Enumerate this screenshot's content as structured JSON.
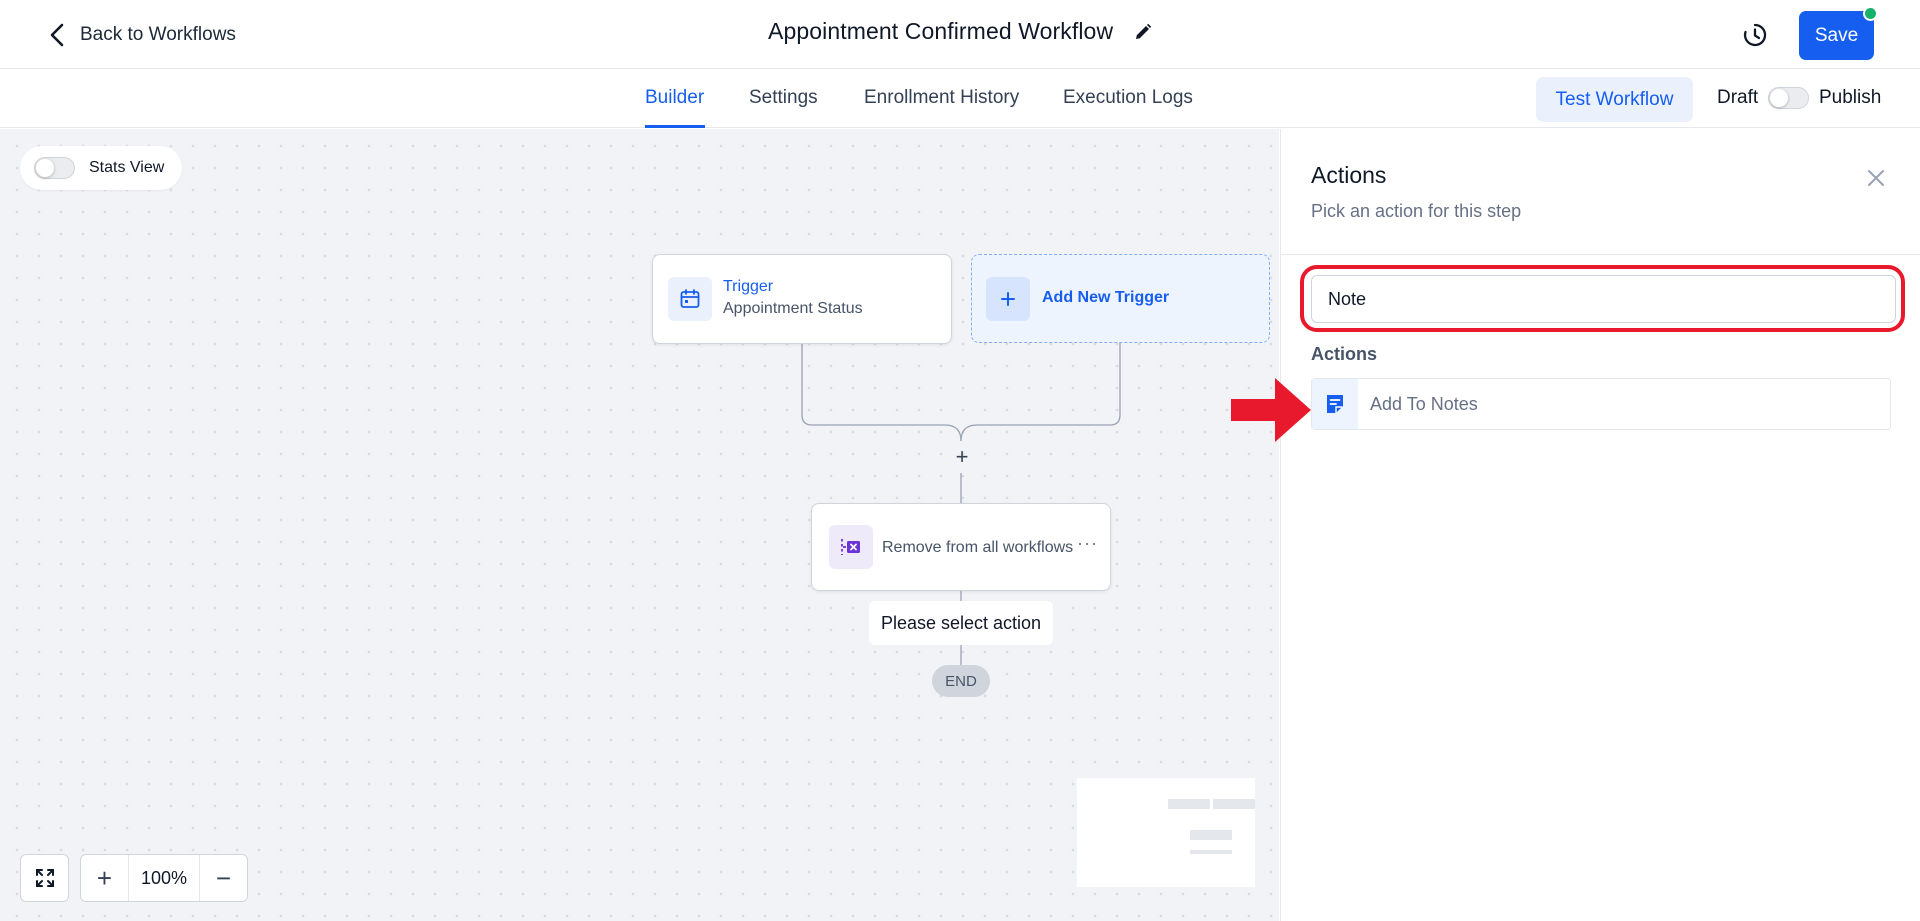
{
  "header": {
    "back_label": "Back to Workflows",
    "title": "Appointment Confirmed Workflow",
    "save_label": "Save"
  },
  "tabs": [
    {
      "label": "Builder",
      "active": true
    },
    {
      "label": "Settings",
      "active": false
    },
    {
      "label": "Enrollment History",
      "active": false
    },
    {
      "label": "Execution Logs",
      "active": false
    }
  ],
  "toolbar": {
    "test_label": "Test Workflow",
    "draft_label": "Draft",
    "publish_label": "Publish",
    "published": false
  },
  "canvas": {
    "stats_label": "Stats View",
    "stats_on": false,
    "trigger": {
      "label": "Trigger",
      "subtitle": "Appointment Status"
    },
    "add_trigger_label": "Add New Trigger",
    "action": {
      "label": "Remove from all workflows",
      "more": "···"
    },
    "select_action_label": "Please select action",
    "end_label": "END",
    "add_step_symbol": "+",
    "zoom": {
      "value": "100%",
      "in": "+",
      "out": "−"
    }
  },
  "panel": {
    "title": "Actions",
    "subtitle": "Pick an action for this step",
    "search_value": "Note",
    "section_label": "Actions",
    "options": [
      {
        "label": "Add To Notes",
        "icon": "note-icon"
      }
    ]
  },
  "colors": {
    "primary": "#155eef",
    "annotation": "#e8192c",
    "status_dot": "#17b26a"
  }
}
